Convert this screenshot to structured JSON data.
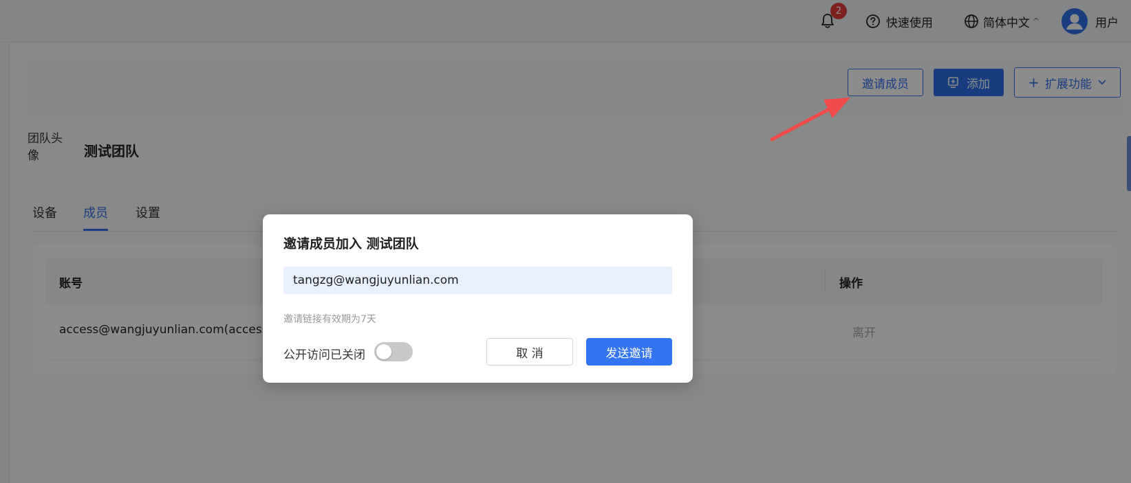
{
  "topbar": {
    "notification_count": "2",
    "quick_start_label": "快速使用",
    "language_label": "简体中文",
    "language_caret": "^",
    "user_label": "用户"
  },
  "actions": {
    "invite_member_label": "邀请成员",
    "add_label": "添加",
    "extensions_label": "扩展功能"
  },
  "team": {
    "avatar_alt": "团队头像",
    "name": "测试团队"
  },
  "tabs": [
    {
      "label": "设备"
    },
    {
      "label": "成员"
    },
    {
      "label": "设置"
    }
  ],
  "table": {
    "columns": [
      "账号",
      "操作"
    ],
    "rows": [
      {
        "account": "access@wangjuyunlian.com(access)",
        "action": "离开"
      }
    ]
  },
  "modal": {
    "title": "邀请成员加入 测试团队",
    "email_value": "tangzg@wangjuyunlian.com",
    "hint": "邀请链接有效期为7天",
    "public_access_label": "公开访问已关闭",
    "cancel_label": "取 消",
    "send_label": "发送邀请"
  },
  "colors": {
    "accent": "#2f6fe8",
    "badge": "#e23b3b",
    "annotation_arrow": "#f04a4a"
  },
  "icons": [
    "bell-icon",
    "help-circle-icon",
    "globe-icon",
    "user-avatar-icon",
    "add-box-icon",
    "plus-icon",
    "chevron-down-icon"
  ]
}
